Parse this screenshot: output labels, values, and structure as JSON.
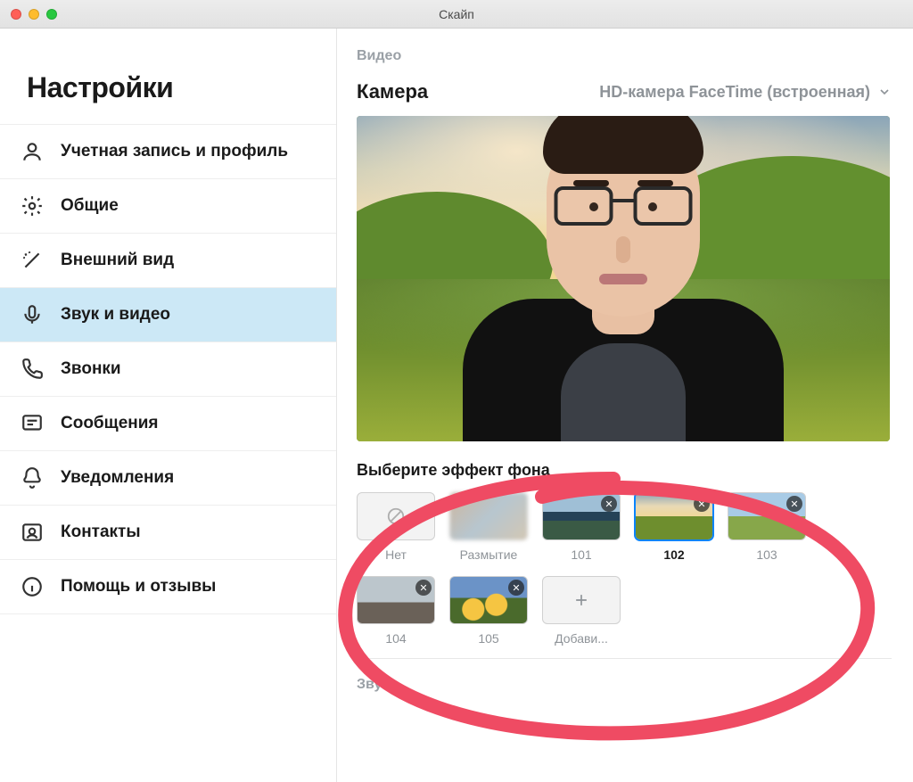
{
  "window": {
    "title": "Скайп"
  },
  "sidebar": {
    "title": "Настройки",
    "items": [
      {
        "label": "Учетная запись и профиль",
        "icon": "profile"
      },
      {
        "label": "Общие",
        "icon": "gear"
      },
      {
        "label": "Внешний вид",
        "icon": "wand"
      },
      {
        "label": "Звук и видео",
        "icon": "mic",
        "active": true
      },
      {
        "label": "Звонки",
        "icon": "phone"
      },
      {
        "label": "Сообщения",
        "icon": "chat"
      },
      {
        "label": "Уведомления",
        "icon": "bell"
      },
      {
        "label": "Контакты",
        "icon": "contact"
      },
      {
        "label": "Помощь и отзывы",
        "icon": "info"
      }
    ]
  },
  "main": {
    "video_section_label": "Видео",
    "camera_label": "Камера",
    "camera_value": "HD-камера FaceTime (встроенная)",
    "bg_heading": "Выберите эффект фона",
    "thumbs": {
      "none": "Нет",
      "blur": "Размытие",
      "b101": "101",
      "b102": "102",
      "b103": "103",
      "b104": "104",
      "b105": "105",
      "add": "Добави..."
    },
    "audio_section_label": "Звук"
  }
}
